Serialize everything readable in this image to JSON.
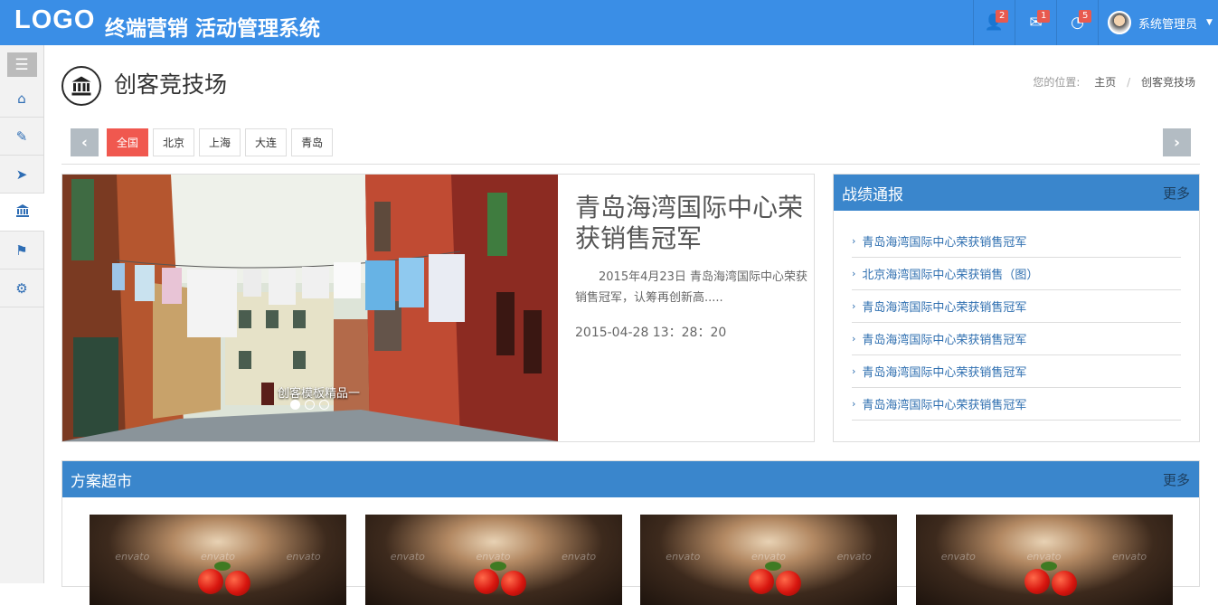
{
  "header": {
    "logo": "LOGO",
    "title": "终端营销 活动管理系统",
    "icons": [
      {
        "name": "user-alert-icon",
        "glyph": "👤",
        "badge": "2"
      },
      {
        "name": "mail-icon",
        "glyph": "✉",
        "badge": "1"
      },
      {
        "name": "chart-icon",
        "glyph": "◔",
        "badge": "5"
      }
    ],
    "user": {
      "name": "系统管理员"
    },
    "colors": {
      "bar": "#3a8ee6",
      "badge": "#e85a4f"
    }
  },
  "sidebar": {
    "menu_icon": "☰",
    "items": [
      {
        "name": "home-icon",
        "glyph": "⌂",
        "active": false
      },
      {
        "name": "edit-icon",
        "glyph": "✎",
        "active": false
      },
      {
        "name": "send-icon",
        "glyph": "➤",
        "active": false
      },
      {
        "name": "bank-icon",
        "glyph": "🏛",
        "active": true
      },
      {
        "name": "flag-icon",
        "glyph": "⚑",
        "active": false
      },
      {
        "name": "gear-icon",
        "glyph": "⚙",
        "active": false
      }
    ]
  },
  "page": {
    "title": "创客竞技场",
    "breadcrumb": {
      "label": "您的位置:",
      "home": "主页",
      "sep": "/",
      "current": "创客竞技场"
    }
  },
  "cities": {
    "prev": "‹",
    "next": "›",
    "items": [
      "全国",
      "北京",
      "上海",
      "大连",
      "青岛"
    ],
    "active_index": 0,
    "active_color": "#f0584f"
  },
  "carousel": {
    "caption": "创客模板精品一",
    "slide_count": 3,
    "active_slide": 0,
    "title": "青岛海湾国际中心荣获销售冠军",
    "desc": "2015年4月23日 青岛海湾国际中心荣获销售冠军，认筹再创新高.....",
    "date": "2015-04-28 13：28：20"
  },
  "reports": {
    "title": "战绩通报",
    "more": "更多",
    "items": [
      "青岛海湾国际中心荣获销售冠军",
      "北京海湾国际中心荣获销售（图）",
      "青岛海湾国际中心荣获销售冠军",
      "青岛海湾国际中心荣获销售冠军",
      "青岛海湾国际中心荣获销售冠军",
      "青岛海湾国际中心荣获销售冠军"
    ]
  },
  "plans": {
    "title": "方案超市",
    "more": "更多",
    "watermark": "envato",
    "cards": 4
  }
}
